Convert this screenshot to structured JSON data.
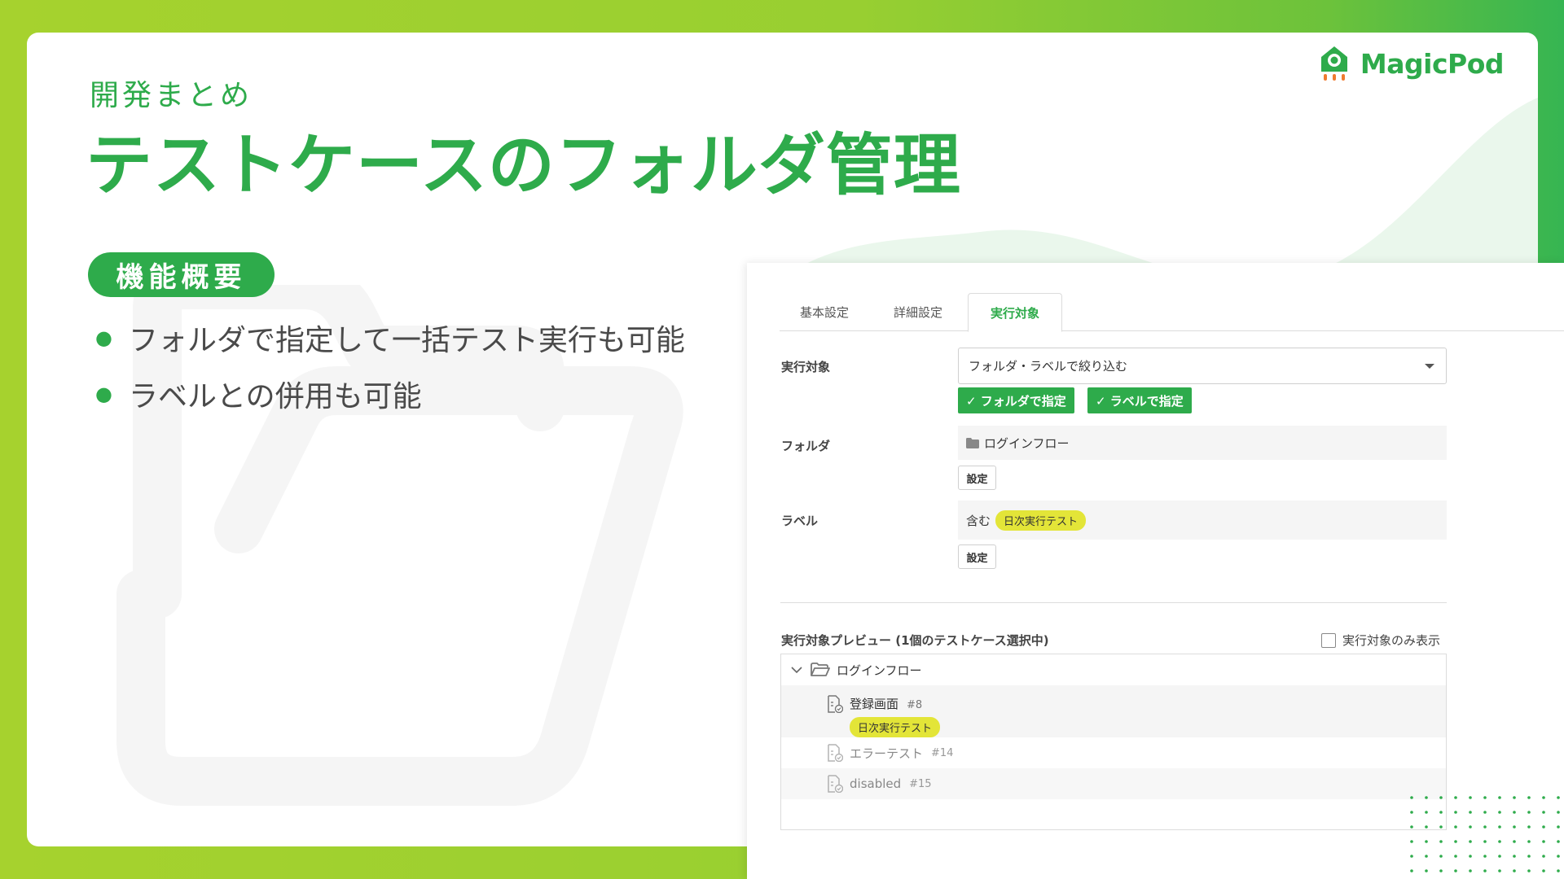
{
  "slide": {
    "eyebrow": "開発まとめ",
    "title": "テストケースのフォルダ管理",
    "badge": "機能概要",
    "bullets": [
      "フォルダで指定して一括テスト実行も可能",
      "ラベルとの併用も可能"
    ]
  },
  "logo": {
    "text": "MagicPod",
    "icon": "rocket-icon"
  },
  "colors": {
    "brand": "#2eab4b",
    "lime": "#a6d22e",
    "tag_yellow": "#e3e538"
  },
  "panel": {
    "tabs": [
      {
        "label": "基本設定",
        "active": false
      },
      {
        "label": "詳細設定",
        "active": false
      },
      {
        "label": "実行対象",
        "active": true
      }
    ],
    "target": {
      "label": "実行対象",
      "select_value": "フォルダ・ラベルで絞り込む",
      "toggles": [
        "✓ フォルダで指定",
        "✓ ラベルで指定"
      ]
    },
    "folder": {
      "label": "フォルダ",
      "value": "ログインフロー",
      "button": "設定"
    },
    "label_filter": {
      "label": "ラベル",
      "prefix": "含む",
      "tag": "日次実行テスト",
      "button": "設定"
    },
    "preview": {
      "title": "実行対象プレビュー (1個のテストケース選択中)",
      "checkbox_label": "実行対象のみ表示",
      "checkbox_checked": false,
      "folder_name": "ログインフロー",
      "cases": [
        {
          "name": "登録画面",
          "number": "#8",
          "tag": "日次実行テスト",
          "selected": true
        },
        {
          "name": "エラーテスト",
          "number": "#14",
          "selected": false
        },
        {
          "name": "disabled",
          "number": "#15",
          "selected": false
        }
      ]
    }
  }
}
